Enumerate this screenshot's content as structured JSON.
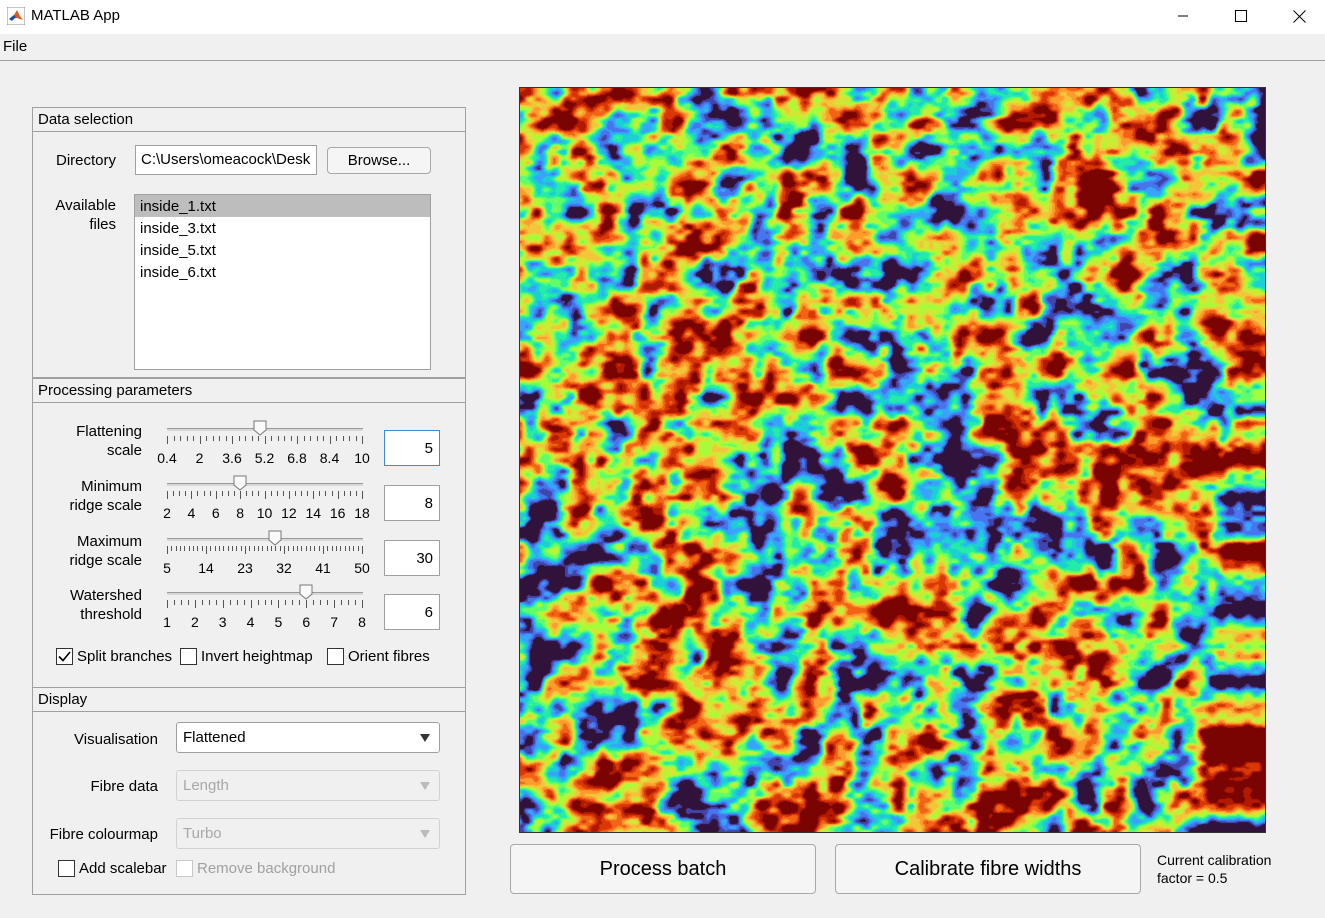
{
  "window": {
    "title": "MATLAB App",
    "controls": [
      "minimize-icon",
      "maximize-icon",
      "close-icon"
    ]
  },
  "menu": {
    "file": "File"
  },
  "data_selection": {
    "title": "Data selection",
    "directory_label": "Directory",
    "directory_value": "C:\\Users\\omeacock\\Desk",
    "browse_label": "Browse...",
    "files_label_1": "Available",
    "files_label_2": "files",
    "files": [
      "inside_1.txt",
      "inside_3.txt",
      "inside_5.txt",
      "inside_6.txt"
    ],
    "selected_file": "inside_1.txt"
  },
  "processing": {
    "title": "Processing parameters",
    "sliders": [
      {
        "label_1": "Flattening",
        "label_2": "scale",
        "min": 0.4,
        "max": 10,
        "value": 5,
        "value_text": "5",
        "tick_labels": [
          "0.4",
          "2",
          "3.6",
          "5.2",
          "6.8",
          "8.4",
          "10"
        ],
        "minor_per_major": 5,
        "focused": true
      },
      {
        "label_1": "Minimum",
        "label_2": "ridge scale",
        "min": 2,
        "max": 18,
        "value": 8,
        "value_text": "8",
        "tick_labels": [
          "2",
          "4",
          "6",
          "8",
          "10",
          "12",
          "14",
          "16",
          "18"
        ],
        "minor_per_major": 4,
        "focused": false
      },
      {
        "label_1": "Maximum",
        "label_2": "ridge scale",
        "min": 5,
        "max": 50,
        "value": 30,
        "value_text": "30",
        "tick_labels": [
          "5",
          "14",
          "23",
          "32",
          "41",
          "50"
        ],
        "minor_per_major": 9,
        "focused": false
      },
      {
        "label_1": "Watershed",
        "label_2": "threshold",
        "min": 1,
        "max": 8,
        "value": 6,
        "value_text": "6",
        "tick_labels": [
          "1",
          "2",
          "3",
          "4",
          "5",
          "6",
          "7",
          "8"
        ],
        "minor_per_major": 4,
        "focused": false
      }
    ],
    "checkboxes": [
      {
        "label": "Split branches",
        "checked": true
      },
      {
        "label": "Invert heightmap",
        "checked": false
      },
      {
        "label": "Orient fibres",
        "checked": false
      }
    ]
  },
  "display": {
    "title": "Display",
    "visualisation_label": "Visualisation",
    "visualisation_value": "Flattened",
    "fibre_data_label": "Fibre data",
    "fibre_data_value": "Length",
    "fibre_colourmap_label": "Fibre colourmap",
    "fibre_colourmap_value": "Turbo",
    "add_scalebar_label": "Add scalebar",
    "add_scalebar_checked": false,
    "remove_background_label": "Remove background",
    "remove_background_checked": false
  },
  "image": {
    "description_colormap": "turbo",
    "colors": [
      "#30123b",
      "#4145ab",
      "#4675ed",
      "#39a2fc",
      "#1bcfd4",
      "#24eca6",
      "#61fc6c",
      "#a4fc3b",
      "#d1e834",
      "#f3c63a",
      "#fe9b2d",
      "#f36315",
      "#d93806",
      "#b11901",
      "#7a0402"
    ]
  },
  "actions": {
    "process_batch": "Process batch",
    "calibrate": "Calibrate fibre widths",
    "calibration_line_1": "Current calibration",
    "calibration_line_2": "factor = 0.5"
  }
}
